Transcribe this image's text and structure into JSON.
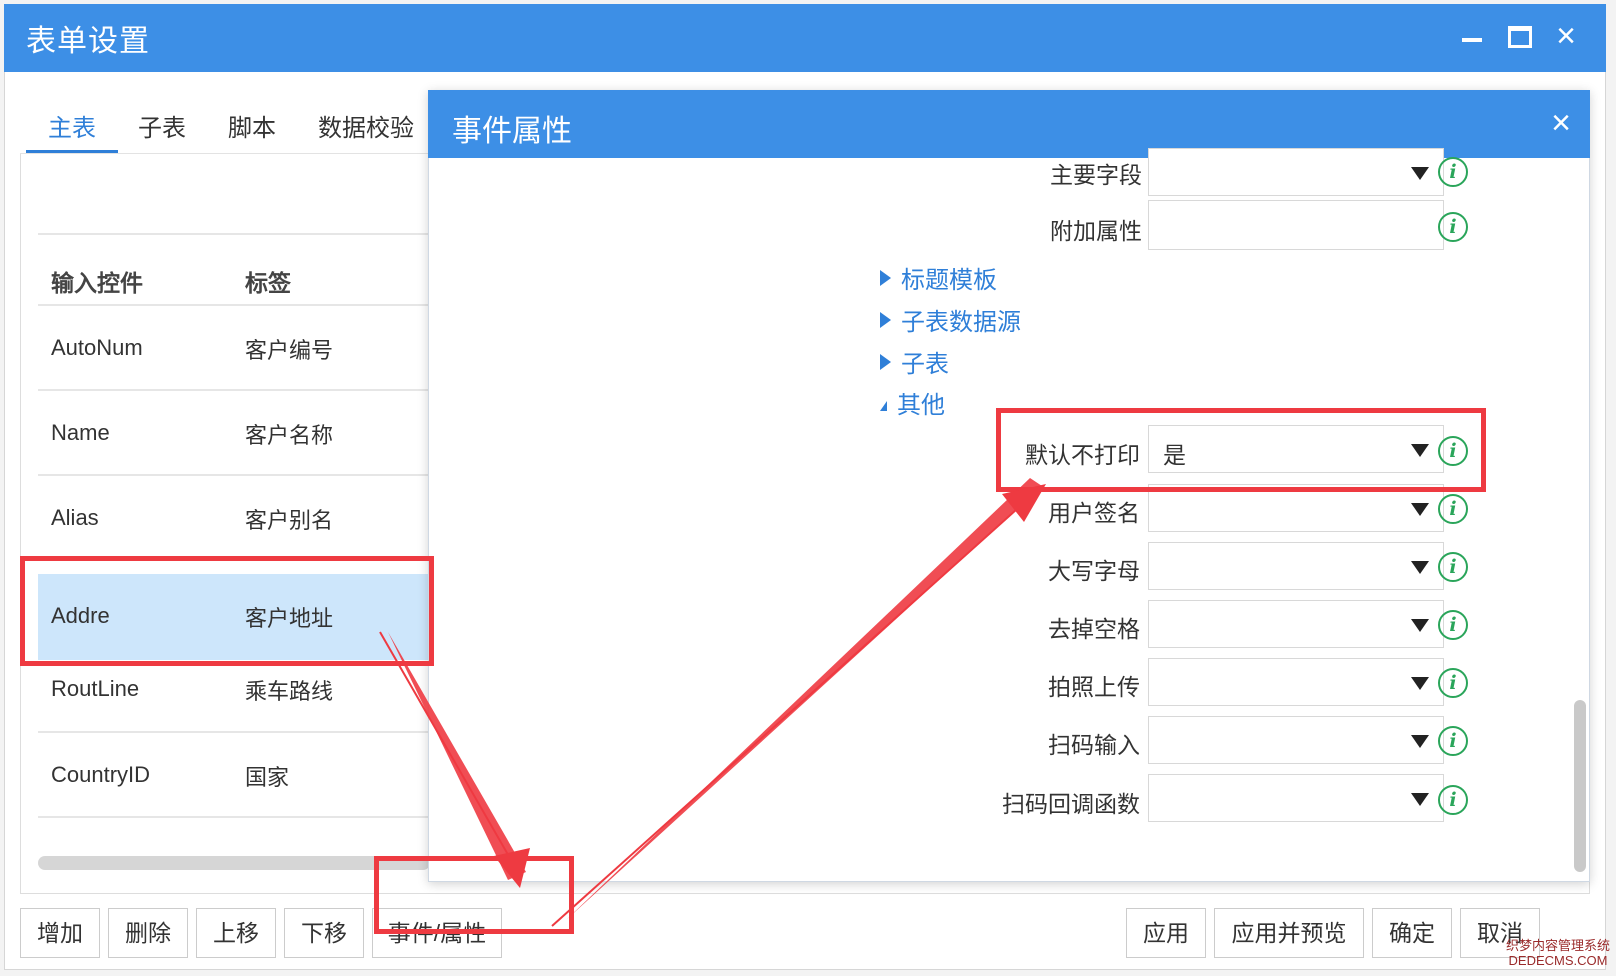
{
  "window": {
    "title": "表单设置",
    "controls": {
      "minimize": "minimize-icon",
      "maximize": "maximize-icon",
      "close": "×"
    }
  },
  "tabs": [
    {
      "label": "主表",
      "active": true
    },
    {
      "label": "子表"
    },
    {
      "label": "脚本"
    },
    {
      "label": "数据校验"
    }
  ],
  "table": {
    "headers": [
      "输入控件",
      "标签"
    ],
    "rows": [
      {
        "control": "AutoNum",
        "label": "客户编号"
      },
      {
        "control": "Name",
        "label": "客户名称"
      },
      {
        "control": "Alias",
        "label": "客户别名"
      },
      {
        "control": "Addre",
        "label": "客户地址",
        "selected": true
      },
      {
        "control": "RoutLine",
        "label": "乘车路线"
      },
      {
        "control": "CountryID",
        "label": "国家"
      }
    ]
  },
  "bottom_buttons": {
    "left": [
      "增加",
      "删除",
      "上移",
      "下移",
      "事件/属性"
    ],
    "right": [
      "应用",
      "应用并预览",
      "确定",
      "取消"
    ]
  },
  "dialog": {
    "title": "事件属性",
    "close": "×",
    "top_properties": [
      {
        "label": "主要字段",
        "value": "",
        "type": "select"
      },
      {
        "label": "附加属性",
        "value": "",
        "type": "text"
      }
    ],
    "groups": [
      {
        "label": "标题模板",
        "expanded": false
      },
      {
        "label": "子表数据源",
        "expanded": false
      },
      {
        "label": "子表",
        "expanded": false
      },
      {
        "label": "其他",
        "expanded": true
      }
    ],
    "other_properties": [
      {
        "label": "默认不打印",
        "value": "是"
      },
      {
        "label": "用户签名",
        "value": ""
      },
      {
        "label": "大写字母",
        "value": ""
      },
      {
        "label": "去掉空格",
        "value": ""
      },
      {
        "label": "拍照上传",
        "value": ""
      },
      {
        "label": "扫码输入",
        "value": ""
      },
      {
        "label": "扫码回调函数",
        "value": ""
      }
    ],
    "info_icon": "i"
  },
  "annotation_color": "#ee3a41",
  "accent_color": "#3d8fe6",
  "watermark": [
    "织梦内容管理系统",
    "DEDECMS.COM"
  ]
}
